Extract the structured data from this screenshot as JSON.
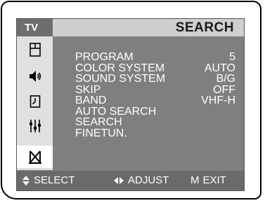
{
  "header": {
    "badge": "TV",
    "title": "SEARCH"
  },
  "sidebar": {
    "items": [
      {
        "icon": "picture-icon"
      },
      {
        "icon": "sound-icon"
      },
      {
        "icon": "clock-icon"
      },
      {
        "icon": "function-icon"
      },
      {
        "icon": "channel-search-icon",
        "active": true
      }
    ]
  },
  "menu": {
    "items": [
      {
        "label": "PROGRAM",
        "value": "5"
      },
      {
        "label": "COLOR SYSTEM",
        "value": "AUTO"
      },
      {
        "label": "SOUND SYSTEM",
        "value": "B/G"
      },
      {
        "label": "SKIP",
        "value": "OFF"
      },
      {
        "label": "BAND",
        "value": "VHF-H"
      },
      {
        "label": "AUTO SEARCH",
        "value": ""
      },
      {
        "label": "SEARCH",
        "value": ""
      },
      {
        "label": "FINETUN.",
        "value": ""
      }
    ]
  },
  "footer": {
    "select_label": "SELECT",
    "adjust_label": "ADJUST",
    "exit_key": "M",
    "exit_label": "EXIT"
  },
  "colors": {
    "screen_bg": "#7f7f7f",
    "titlebar_bg": "#cfcfcf",
    "sidebar_bg": "#e0e0e0",
    "footer_bg": "#6a6a6a",
    "text": "#ffffff"
  }
}
